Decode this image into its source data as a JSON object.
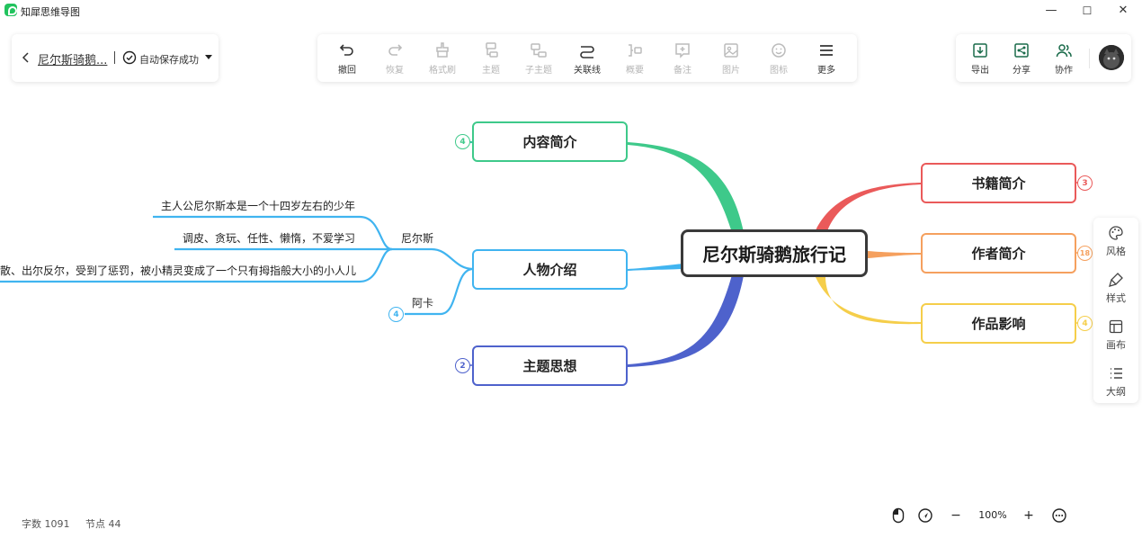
{
  "app": {
    "name": "知犀思维导图"
  },
  "window": {
    "minimize": "—",
    "maximize": "☐",
    "close": "✕"
  },
  "document": {
    "title": "尼尔斯骑鹅...",
    "save_status": "自动保存成功"
  },
  "toolbar": [
    {
      "id": "undo",
      "label": "撤回",
      "icon": "undo-icon",
      "enabled": true
    },
    {
      "id": "redo",
      "label": "恢复",
      "icon": "redo-icon",
      "enabled": false
    },
    {
      "id": "format-brush",
      "label": "格式刷",
      "icon": "format-brush-icon",
      "enabled": false
    },
    {
      "id": "topic",
      "label": "主题",
      "icon": "topic-icon",
      "enabled": false
    },
    {
      "id": "subtopic",
      "label": "子主题",
      "icon": "subtopic-icon",
      "enabled": false
    },
    {
      "id": "relation-line",
      "label": "关联线",
      "icon": "relation-line-icon",
      "enabled": true
    },
    {
      "id": "summary",
      "label": "概要",
      "icon": "summary-icon",
      "enabled": false
    },
    {
      "id": "note",
      "label": "备注",
      "icon": "note-icon",
      "enabled": false
    },
    {
      "id": "image",
      "label": "图片",
      "icon": "image-icon",
      "enabled": false
    },
    {
      "id": "emoji",
      "label": "图标",
      "icon": "emoji-icon",
      "enabled": false
    },
    {
      "id": "more",
      "label": "更多",
      "icon": "more-icon",
      "enabled": true
    }
  ],
  "header_actions": [
    {
      "id": "export",
      "label": "导出",
      "icon": "export-icon"
    },
    {
      "id": "share",
      "label": "分享",
      "icon": "share-icon"
    },
    {
      "id": "collaborate",
      "label": "协作",
      "icon": "collaborate-icon"
    }
  ],
  "side_panel": [
    {
      "id": "style",
      "label": "风格",
      "icon": "palette-icon"
    },
    {
      "id": "format",
      "label": "样式",
      "icon": "brush-icon"
    },
    {
      "id": "canvas",
      "label": "画布",
      "icon": "layout-icon"
    },
    {
      "id": "outline",
      "label": "大纲",
      "icon": "list-icon"
    }
  ],
  "mindmap": {
    "root": "尼尔斯骑鹅旅行记",
    "branches": {
      "content_intro": {
        "label": "内容简介",
        "color": "#3ec98a",
        "collapsed_count": "4"
      },
      "characters": {
        "label": "人物介绍",
        "color": "#40b4f0"
      },
      "theme": {
        "label": "主题思想",
        "color": "#4e62cc",
        "collapsed_count": "2"
      },
      "book_intro": {
        "label": "书籍简介",
        "color": "#ea5a5a",
        "collapsed_count": "3"
      },
      "author_intro": {
        "label": "作者简介",
        "color": "#f5a05e",
        "collapsed_count": "18"
      },
      "influence": {
        "label": "作品影响",
        "color": "#f5ce4a",
        "collapsed_count": "4"
      }
    },
    "character_children": {
      "nils": {
        "label": "尼尔斯",
        "details": [
          "主人公尼尔斯本是一个十四岁左右的少年",
          "调皮、贪玩、任性、懒惰，不爱学习",
          "散、出尔反尔，受到了惩罚，被小精灵变成了一个只有拇指般大小的小人儿"
        ]
      },
      "aka": {
        "label": "阿卡",
        "collapsed_count": "4"
      }
    }
  },
  "status": {
    "word_count": "字数 1091",
    "node_count": "节点 44"
  },
  "zoom": {
    "minus": "−",
    "value": "100%",
    "plus": "+"
  }
}
